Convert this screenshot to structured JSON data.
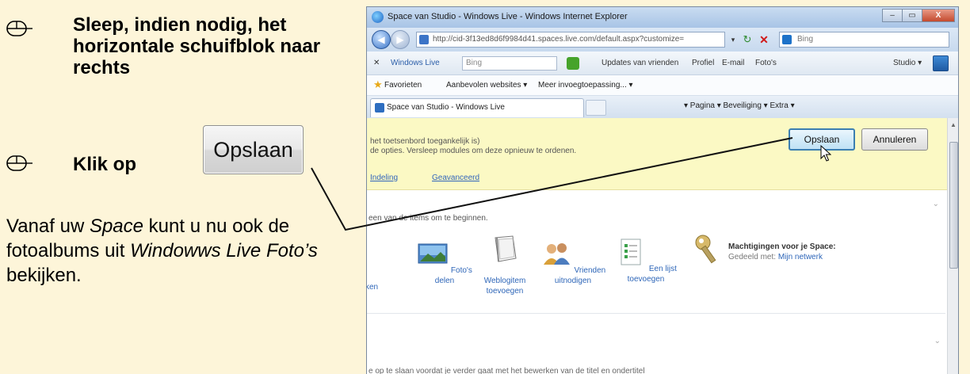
{
  "instructions": {
    "step1_text": "Sleep, indien nodig, het horizontale schuifblok naar rechts",
    "step2_prefix": "Klik op",
    "step2_button": "Opslaan",
    "para_1": "Vanaf uw ",
    "para_space": "Space",
    "para_2": " kunt u nu ook de fotoalbums uit ",
    "para_wlf": "Windowws Live Foto’s",
    "para_3": " bekijken.",
    "mouse_icon": "mouse-right-icon"
  },
  "browser": {
    "title": "Space van Studio - Windows Live - Windows Internet Explorer",
    "window_buttons": [
      "–",
      "▭",
      "X"
    ],
    "address": "http://cid-3f13ed8d6f9984d41.spaces.live.com/default.aspx?customize=",
    "search_placeholder": "Bing",
    "back": "◀",
    "forward": "▶",
    "refresh": "↻",
    "stop": "✕",
    "dropdown": "▾",
    "toolbar": {
      "close": "✕",
      "brand": "Windows Live",
      "search_value": "Bing",
      "items": [
        "Updates van vrienden",
        "Profiel",
        "E-mail",
        "Foto's"
      ],
      "studio": "Studio ▾"
    },
    "favorites": {
      "label": "Favorieten",
      "sites": "Aanbevolen websites ▾",
      "addons": "Meer invoegtoepassing... ▾"
    },
    "tab_title": "Space van Studio - Windows Live",
    "commands": "▾  Pagina ▾  Beveiliging ▾  Extra ▾"
  },
  "page": {
    "yellow_line1": "het toetsenbord toegankelijk is)",
    "yellow_line2": "de opties. Versleep modules om deze opnieuw te ordenen.",
    "link_layout": "Indeling",
    "link_advanced": "Geavanceerd",
    "save_button": "Opslaan",
    "cancel_button": "Annuleren",
    "panel_intro": "een van de items om te beginnen.",
    "features": [
      {
        "label": "ken",
        "sub": ""
      },
      {
        "label": "Foto's delen",
        "sub": ""
      },
      {
        "label": "Weblogitem",
        "sub": "toevoegen"
      },
      {
        "label": "Vrienden",
        "sub": "uitnodigen"
      },
      {
        "label": "Een lijst",
        "sub": "toevoegen"
      }
    ],
    "perm_title": "Machtigingen voor je Space:",
    "perm_prefix": "Gedeeld met: ",
    "perm_link": "Mijn netwerk",
    "bottom_text": "e op te slaan voordat je verder gaat met het bewerken van de titel en ondertitel"
  }
}
